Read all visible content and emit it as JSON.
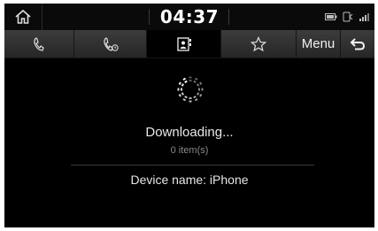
{
  "status": {
    "time": "04:37"
  },
  "tabs": [
    {
      "icon": "phone-call-icon"
    },
    {
      "icon": "recent-calls-icon"
    },
    {
      "icon": "contacts-icon",
      "active": true
    },
    {
      "icon": "favorites-star-icon"
    }
  ],
  "tabbar": {
    "menu_label": "Menu",
    "back_icon": "back-arrow-icon"
  },
  "content": {
    "status_text": "Downloading...",
    "item_count": "0 item(s)",
    "device_label": "Device name: iPhone"
  },
  "colors": {
    "background": "#000000",
    "tabbar": "#2e2e2e",
    "text": "#e6e6e6",
    "muted_text": "#8a8a8a"
  }
}
